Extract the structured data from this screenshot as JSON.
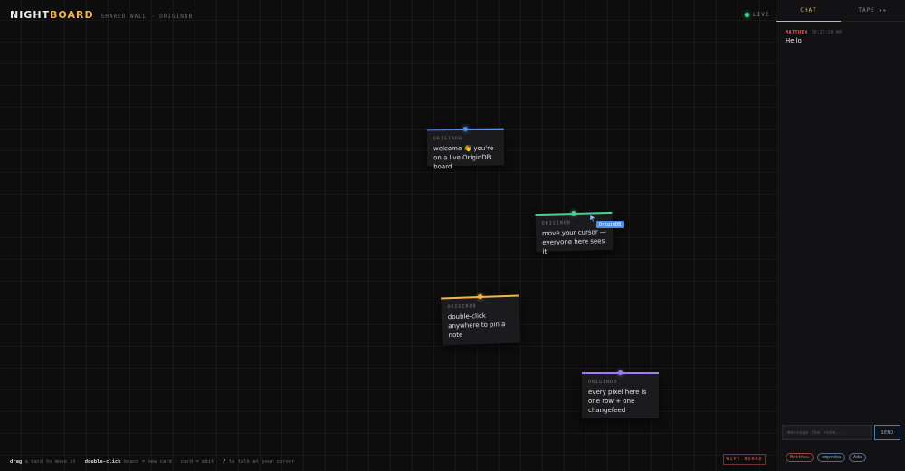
{
  "header": {
    "brand_part1": "NIGHT",
    "brand_part2": "BOARD",
    "subtitle": "SHARED WALL · ORIGINDB",
    "live_label": "LIVE"
  },
  "cards": [
    {
      "owner": "ORIGINDB",
      "text": "welcome 👋 you're on a live OriginDB board",
      "accent": "#5b8cf0"
    },
    {
      "owner": "ORIGINDB",
      "text": "move your cursor — everyone here sees it",
      "accent": "#4cd08a"
    },
    {
      "owner": "ORIGINDB",
      "text": "double-click anywhere to pin a note",
      "accent": "#f0b54a"
    },
    {
      "owner": "ORIGINDB",
      "text": "every pixel here is one row + one changefeed",
      "accent": "#a07cf0"
    }
  ],
  "remote_cursor": {
    "label": "OriginDB",
    "color": "#4a8cf0"
  },
  "footer": {
    "hint_drag_key": "drag",
    "hint_drag_text": "a card to move it",
    "hint_dbl_key": "double-click",
    "hint_dbl_text": "board = new card · card = edit",
    "hint_slash_key": "/",
    "hint_slash_text": "to talk at your cursor",
    "wipe_label": "WIPE BOARD"
  },
  "sidebar": {
    "tabs": [
      {
        "label": "CHAT",
        "active": true
      },
      {
        "label": "TAPE ▸▸",
        "active": false
      }
    ],
    "messages": [
      {
        "user": "MATTHEW",
        "time": "10:23:28 AM",
        "text": "Hello"
      }
    ],
    "compose_placeholder": "message the room...",
    "send_label": "SEND",
    "users": [
      {
        "name": "Matthew",
        "color": "#e0605a"
      },
      {
        "name": "empreba",
        "color": "#7fb2d8"
      },
      {
        "name": "Ada",
        "color": "#9fb4d6"
      }
    ]
  }
}
